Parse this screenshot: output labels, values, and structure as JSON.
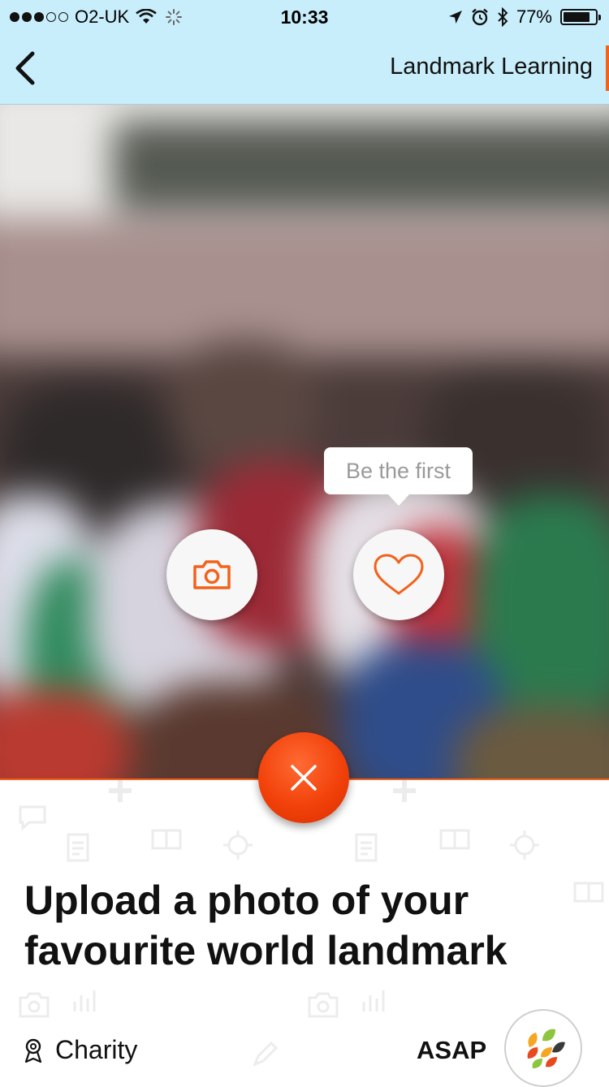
{
  "status_bar": {
    "carrier": "O2-UK",
    "time": "10:33",
    "battery": "77%",
    "battery_level": 0.77,
    "signal_bars_filled": 3,
    "signal_bars_total": 5
  },
  "nav": {
    "title": "Landmark Learning",
    "accent_color": "#f2621b",
    "background": "#c9eefb"
  },
  "hero": {
    "tooltip": "Be the first"
  },
  "task": {
    "headline": "Upload a photo of your favourite world landmark",
    "category": "Charity",
    "deadline": "ASAP"
  },
  "icons": {
    "back": "chevron-left-icon",
    "camera": "camera-icon",
    "like": "heart-icon",
    "close": "close-icon",
    "location": "location-pin-icon",
    "logo": "leaf-logo-icon"
  }
}
